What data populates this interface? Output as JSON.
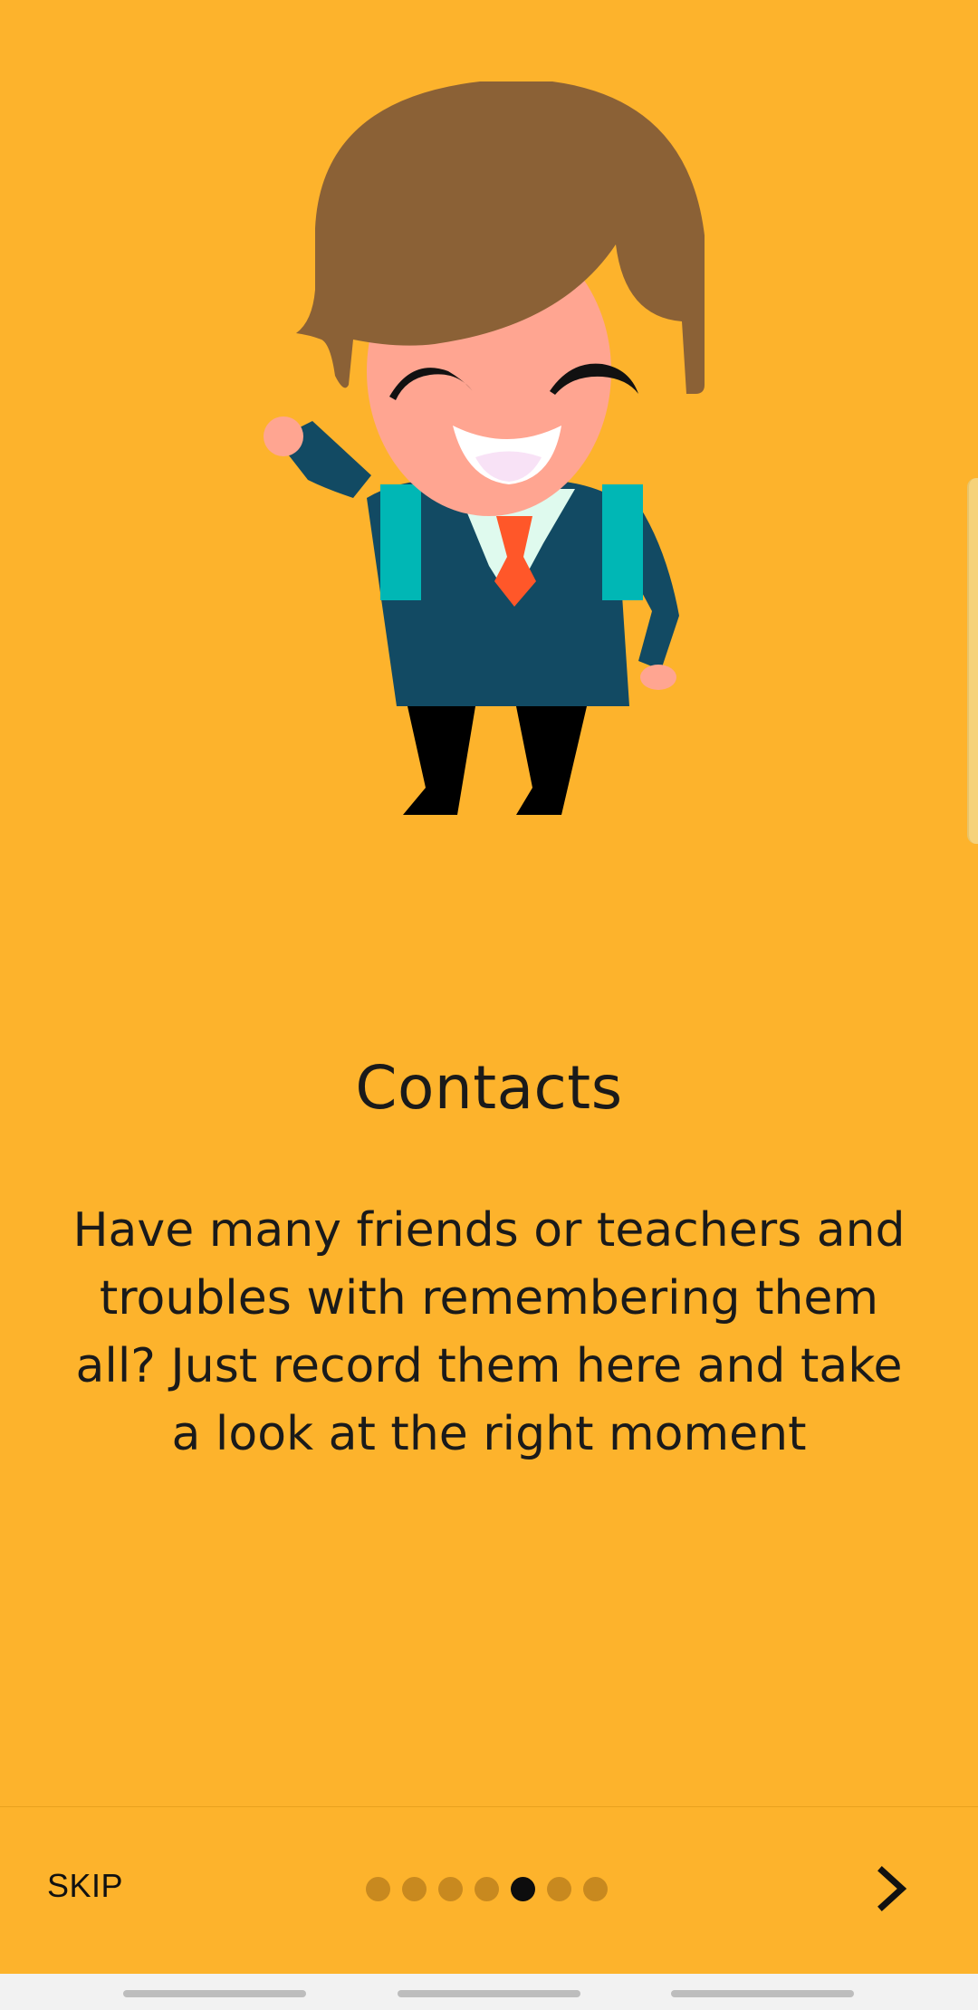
{
  "onboarding": {
    "title": "Contacts",
    "description": "Have many friends or teachers and troubles with remembering them all? Just record them here and take a look at the right moment",
    "illustration": "waving-student-character"
  },
  "bottom_bar": {
    "skip_label": "SKIP",
    "page_count": 7,
    "current_page": 5,
    "next_icon": "chevron-right-icon"
  },
  "colors": {
    "background": "#FDB32C",
    "text": "#1a1a1a",
    "dot_inactive": "#C8891F",
    "dot_active": "#0d0d0d"
  }
}
